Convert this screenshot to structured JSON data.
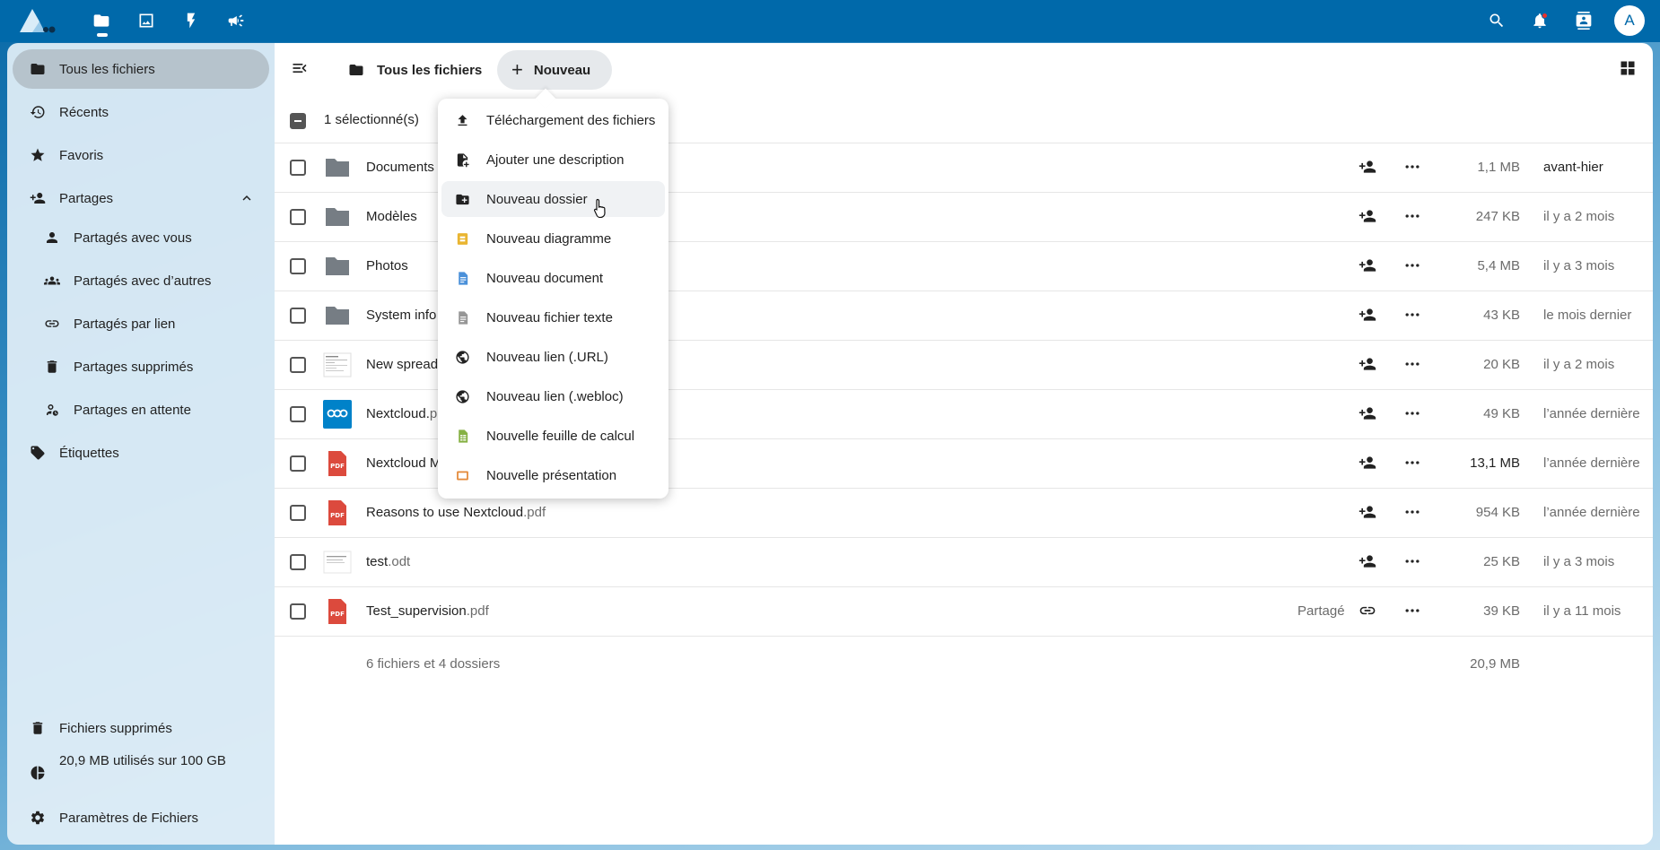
{
  "header": {
    "apps": [
      "files-icon",
      "photos-icon",
      "activity-icon",
      "announcements-icon"
    ],
    "right": [
      "search-icon",
      "notifications-icon",
      "contacts-icon"
    ],
    "avatar_letter": "A"
  },
  "sidebar": {
    "items": [
      {
        "label": "Tous les fichiers",
        "icon": "folder-icon",
        "active": true
      },
      {
        "label": "Récents",
        "icon": "history-icon"
      },
      {
        "label": "Favoris",
        "icon": "star-icon"
      },
      {
        "label": "Partages",
        "icon": "share-icon"
      },
      {
        "label": "Partagés avec vous",
        "icon": "user-icon"
      },
      {
        "label": "Partagés avec d’autres",
        "icon": "users-icon"
      },
      {
        "label": "Partagés par lien",
        "icon": "link-icon"
      },
      {
        "label": "Partages supprimés",
        "icon": "trash-icon"
      },
      {
        "label": "Partages en attente",
        "icon": "pending-user-icon"
      },
      {
        "label": "Étiquettes",
        "icon": "tags-icon"
      }
    ],
    "footer": {
      "trash": "Fichiers supprimés",
      "quota": "20,9 MB utilisés sur 100 GB",
      "settings": "Paramètres de Fichiers"
    }
  },
  "main": {
    "breadcrumb": "Tous les fichiers",
    "new_button": "Nouveau",
    "selection": "1 sélectionné(s)",
    "files": [
      {
        "name": "Documents",
        "ext": "",
        "type": "folder",
        "size": "1,1 MB",
        "date": "avant-hier"
      },
      {
        "name": "Modèles",
        "ext": "",
        "type": "folder",
        "size": "247 KB",
        "date": "il y a 2 mois"
      },
      {
        "name": "Photos",
        "ext": "",
        "type": "folder",
        "size": "5,4 MB",
        "date": "il y a 3 mois"
      },
      {
        "name": "System info",
        "ext": "",
        "type": "folder",
        "size": "43 KB",
        "date": "le mois dernier"
      },
      {
        "name": "New spread",
        "ext": "",
        "type": "sheet",
        "size": "20 KB",
        "date": "il y a 2 mois"
      },
      {
        "name": "Nextcloud.",
        "ext": "p",
        "type": "nextcloud",
        "size": "49 KB",
        "date": "l’année dernière"
      },
      {
        "name": "Nextcloud M",
        "ext": "",
        "type": "pdf",
        "size": "13,1 MB",
        "date": "l’année dernière"
      },
      {
        "name": "Reasons to use Nextcloud",
        "ext": ".pdf",
        "type": "pdf",
        "size": "954 KB",
        "date": "l’année dernière"
      },
      {
        "name": "test",
        "ext": ".odt",
        "type": "doc",
        "size": "25 KB",
        "date": "il y a 3 mois"
      },
      {
        "name": "Test_supervision",
        "ext": ".pdf",
        "type": "pdf",
        "size": "39 KB",
        "date": "il y a 11 mois",
        "shared": "Partagé"
      }
    ],
    "summary": "6 fichiers et 4 dossiers",
    "summary_size": "20,9 MB"
  },
  "menu": {
    "items": [
      {
        "label": "Téléchargement des fichiers",
        "icon": "upload-icon"
      },
      {
        "label": "Ajouter une description",
        "icon": "file-plus-icon"
      },
      {
        "label": "Nouveau dossier",
        "icon": "folder-plus-icon"
      },
      {
        "label": "Nouveau diagramme",
        "icon": "diagram-icon"
      },
      {
        "label": "Nouveau document",
        "icon": "document-icon"
      },
      {
        "label": "Nouveau fichier texte",
        "icon": "text-file-icon"
      },
      {
        "label": "Nouveau lien (.URL)",
        "icon": "globe-icon"
      },
      {
        "label": "Nouveau lien (.webloc)",
        "icon": "globe-icon"
      },
      {
        "label": "Nouvelle feuille de calcul",
        "icon": "spreadsheet-icon"
      },
      {
        "label": "Nouvelle présentation",
        "icon": "presentation-icon"
      }
    ]
  },
  "colors": {
    "header": "#0069aa",
    "folder": "#767d84",
    "pdf": "#dc4a3d",
    "diagram": "#e9b531",
    "document": "#4a90d9",
    "spreadsheet": "#86b144",
    "presentation": "#e48a3a",
    "nextcloud": "#0082c9"
  }
}
